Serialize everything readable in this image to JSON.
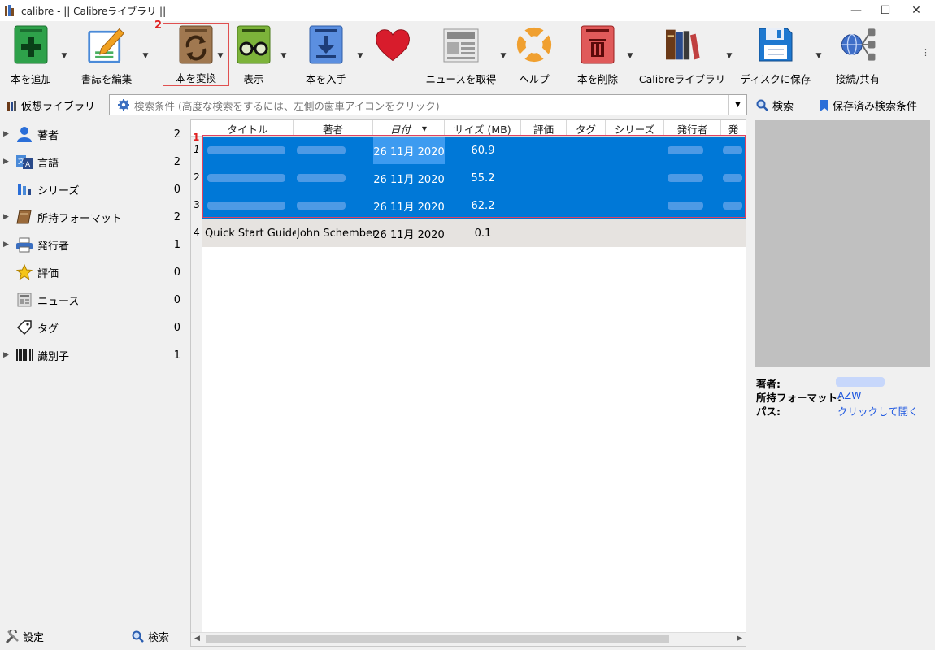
{
  "window": {
    "title": "calibre - || Calibreライブラリ ||",
    "minimize": "—",
    "maximize": "☐",
    "close": "✕"
  },
  "toolbar": {
    "add": "本を追加",
    "edit": "書誌を編集",
    "convert": "本を変換",
    "view": "表示",
    "get": "本を入手",
    "news": "ニュースを取得",
    "help": "ヘルプ",
    "remove": "本を削除",
    "library": "Calibreライブラリ",
    "save": "ディスクに保存",
    "connect": "接続/共有",
    "step_label": "2",
    "more": "⋮"
  },
  "search": {
    "virtual_library": "仮想ライブラリ",
    "placeholder": "検索条件 (高度な検索をするには、左側の歯車アイコンをクリック)",
    "search_button": "検索",
    "saved_searches": "保存済み検索条件"
  },
  "tag_browser": {
    "items": [
      {
        "label": "著者",
        "count": "2",
        "expandable": true
      },
      {
        "label": "言語",
        "count": "2",
        "expandable": true
      },
      {
        "label": "シリーズ",
        "count": "0",
        "expandable": false
      },
      {
        "label": "所持フォーマット",
        "count": "2",
        "expandable": true
      },
      {
        "label": "発行者",
        "count": "1",
        "expandable": true
      },
      {
        "label": "評価",
        "count": "0",
        "expandable": false
      },
      {
        "label": "ニュース",
        "count": "0",
        "expandable": false
      },
      {
        "label": "タグ",
        "count": "0",
        "expandable": false
      },
      {
        "label": "識別子",
        "count": "1",
        "expandable": true
      }
    ],
    "settings": "設定",
    "find": "検索"
  },
  "table": {
    "columns": [
      "タイトル",
      "著者",
      "日付",
      "サイズ (MB)",
      "評価",
      "タグ",
      "シリーズ",
      "発行者",
      "発"
    ],
    "selection_label": "1",
    "rows": [
      {
        "num": "1",
        "title": "",
        "author": "",
        "date": "26 11月 2020",
        "size": "60.9"
      },
      {
        "num": "2",
        "title": "",
        "author": "",
        "date": "26 11月 2020",
        "size": "55.2"
      },
      {
        "num": "3",
        "title": "",
        "author": "",
        "date": "26 11月 2020",
        "size": "62.2"
      },
      {
        "num": "4",
        "title": "Quick Start Guide",
        "author": "John Schember",
        "date": "26 11月 2020",
        "size": "0.1"
      }
    ]
  },
  "details": {
    "author_key": "著者:",
    "format_key": "所持フォーマット:",
    "format_value": "AZW",
    "path_key": "パス:",
    "path_value": "クリックして開く"
  }
}
